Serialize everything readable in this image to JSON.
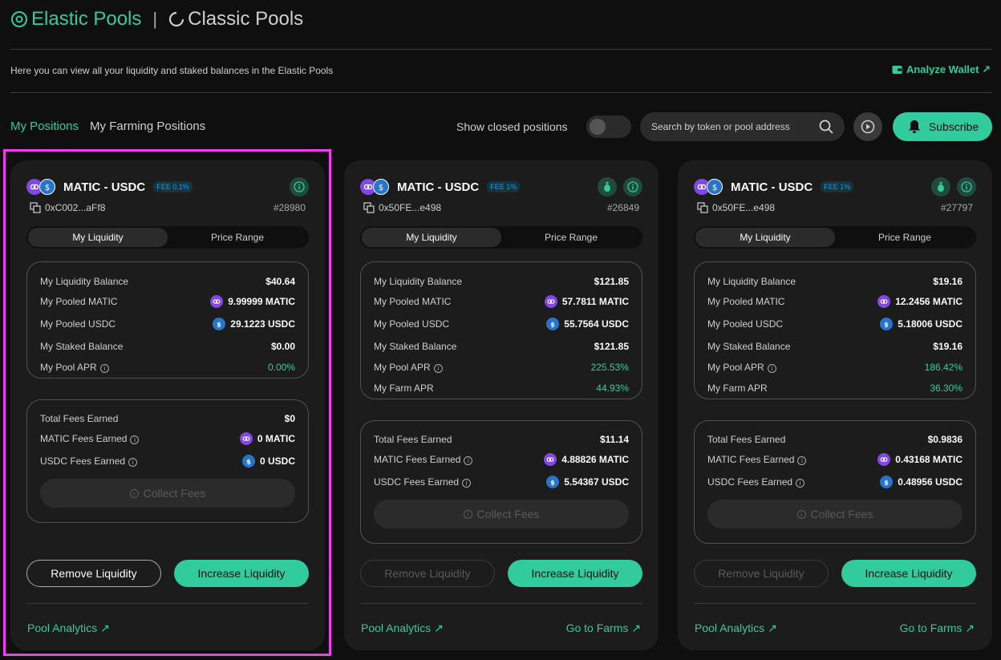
{
  "header": {
    "elastic_label": "Elastic Pools",
    "separator": "|",
    "classic_label": "Classic Pools",
    "subtitle": "Here you can view all your liquidity and staked balances in the Elastic Pools",
    "analyze_label": "Analyze Wallet ↗"
  },
  "toolbar": {
    "tab_positions": "My Positions",
    "tab_farming": "My Farming Positions",
    "show_closed_label": "Show closed positions",
    "search_placeholder": "Search by token or pool address",
    "subscribe_label": "Subscribe"
  },
  "cards": [
    {
      "pair": "MATIC - USDC",
      "fee": "FEE 0.1%",
      "address": "0xC002...aFf8",
      "id": "#28980",
      "seg_liquidity": "My Liquidity",
      "seg_price": "Price Range",
      "liq_balance_label": "My Liquidity Balance",
      "liq_balance": "$40.64",
      "pooled_matic_label": "My Pooled MATIC",
      "pooled_matic": "9.99999 MATIC",
      "pooled_usdc_label": "My Pooled USDC",
      "pooled_usdc": "29.1223 USDC",
      "staked_label": "My Staked Balance",
      "staked": "$0.00",
      "pool_apr_label": "My Pool APR",
      "pool_apr": "0.00%",
      "total_fees_label": "Total Fees Earned",
      "total_fees": "$0",
      "matic_fees_label": "MATIC Fees Earned",
      "matic_fees": "0 MATIC",
      "usdc_fees_label": "USDC Fees Earned",
      "usdc_fees": "0 USDC",
      "collect_label": "Collect Fees",
      "remove_label": "Remove Liquidity",
      "increase_label": "Increase Liquidity",
      "analytics_label": "Pool Analytics ↗"
    },
    {
      "pair": "MATIC - USDC",
      "fee": "FEE 1%",
      "address": "0x50FE...e498",
      "id": "#26849",
      "seg_liquidity": "My Liquidity",
      "seg_price": "Price Range",
      "liq_balance_label": "My Liquidity Balance",
      "liq_balance": "$121.85",
      "pooled_matic_label": "My Pooled MATIC",
      "pooled_matic": "57.7811 MATIC",
      "pooled_usdc_label": "My Pooled USDC",
      "pooled_usdc": "55.7564 USDC",
      "staked_label": "My Staked Balance",
      "staked": "$121.85",
      "pool_apr_label": "My Pool APR",
      "pool_apr": "225.53%",
      "farm_apr_label": "My Farm APR",
      "farm_apr": "44.93%",
      "total_fees_label": "Total Fees Earned",
      "total_fees": "$11.14",
      "matic_fees_label": "MATIC Fees Earned",
      "matic_fees": "4.88826 MATIC",
      "usdc_fees_label": "USDC Fees Earned",
      "usdc_fees": "5.54367 USDC",
      "collect_label": "Collect Fees",
      "remove_label": "Remove Liquidity",
      "increase_label": "Increase Liquidity",
      "analytics_label": "Pool Analytics ↗",
      "farms_label": "Go to Farms ↗"
    },
    {
      "pair": "MATIC - USDC",
      "fee": "FEE 1%",
      "address": "0x50FE...e498",
      "id": "#27797",
      "seg_liquidity": "My Liquidity",
      "seg_price": "Price Range",
      "liq_balance_label": "My Liquidity Balance",
      "liq_balance": "$19.16",
      "pooled_matic_label": "My Pooled MATIC",
      "pooled_matic": "12.2456 MATIC",
      "pooled_usdc_label": "My Pooled USDC",
      "pooled_usdc": "5.18006 USDC",
      "staked_label": "My Staked Balance",
      "staked": "$19.16",
      "pool_apr_label": "My Pool APR",
      "pool_apr": "186.42%",
      "farm_apr_label": "My Farm APR",
      "farm_apr": "36.30%",
      "total_fees_label": "Total Fees Earned",
      "total_fees": "$0.9836",
      "matic_fees_label": "MATIC Fees Earned",
      "matic_fees": "0.43168 MATIC",
      "usdc_fees_label": "USDC Fees Earned",
      "usdc_fees": "0.48956 USDC",
      "collect_label": "Collect Fees",
      "remove_label": "Remove Liquidity",
      "increase_label": "Increase Liquidity",
      "analytics_label": "Pool Analytics ↗",
      "farms_label": "Go to Farms ↗"
    }
  ]
}
